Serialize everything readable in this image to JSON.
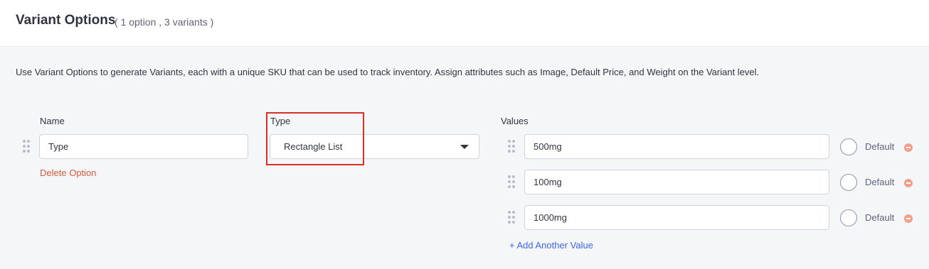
{
  "header": {
    "title": "Variant Options",
    "count_text": "( 1 option , 3 variants )"
  },
  "description": "Use Variant Options to generate Variants, each with a unique SKU that can be used to track inventory. Assign attributes such as Image, Default Price, and Weight on the Variant level.",
  "option": {
    "name_label": "Name",
    "name_value": "Type",
    "type_label": "Type",
    "type_value": "Rectangle List",
    "delete_label": "Delete Option",
    "values_label": "Values",
    "values": [
      {
        "value": "500mg",
        "default_label": "Default"
      },
      {
        "value": "100mg",
        "default_label": "Default"
      },
      {
        "value": "1000mg",
        "default_label": "Default"
      }
    ],
    "add_value_label": "+ Add Another Value"
  },
  "icons": {
    "drag": "drag-handle-icon",
    "caret": "chevron-down-icon",
    "remove": "remove-circle-icon"
  },
  "colors": {
    "accent_link": "#3c64f4",
    "danger_link": "#db5a3c",
    "highlight_box": "#d93025",
    "body_background": "#f5f6f8"
  }
}
